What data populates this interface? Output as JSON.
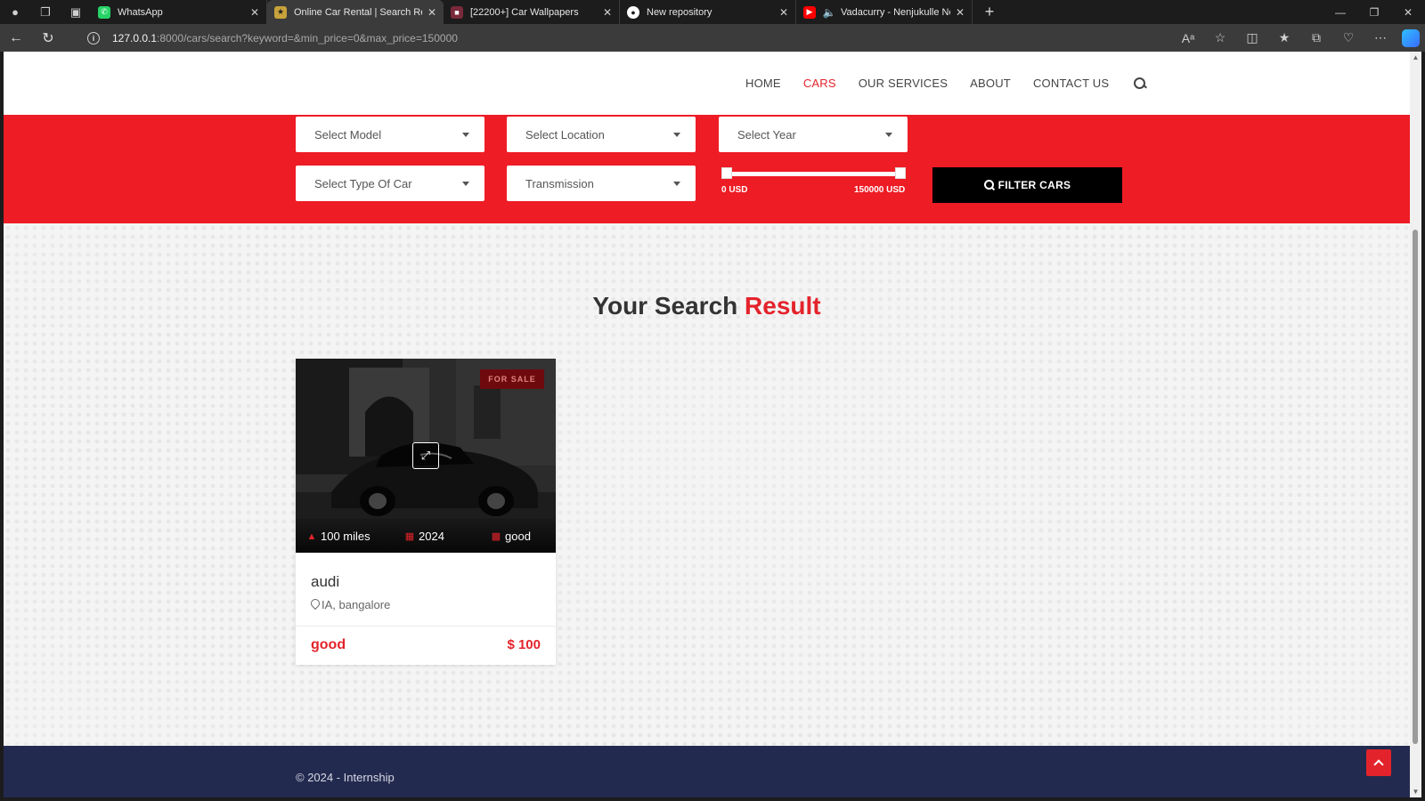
{
  "browser": {
    "tabs": [
      {
        "title": "WhatsApp",
        "favicon": "whatsapp-icon",
        "color": "#25d366"
      },
      {
        "title": "Online Car Rental | Search Result",
        "favicon": "site-icon",
        "color": "#c8a23a"
      },
      {
        "title": "[22200+] Car Wallpapers",
        "favicon": "wallpaper-site-icon",
        "color": "#7a2a3a"
      },
      {
        "title": "New repository",
        "favicon": "github-icon",
        "color": "#ffffff"
      },
      {
        "title": "Vadacurry - Nenjukulle Nee",
        "favicon": "youtube-icon",
        "color": "#ff0000"
      }
    ],
    "url_host": "127.0.0.1",
    "url_path": ":8000/cars/search?keyword=&min_price=0&max_price=150000"
  },
  "nav": {
    "items": [
      "HOME",
      "CARS",
      "OUR SERVICES",
      "ABOUT",
      "CONTACT US"
    ],
    "active": "CARS"
  },
  "filters": {
    "model": "Select Model",
    "location": "Select Location",
    "year": "Select Year",
    "type": "Select Type Of Car",
    "transmission": "Transmission",
    "price_min_label": "0 USD",
    "price_max_label": "150000 USD",
    "button": "FILTER CARS"
  },
  "section": {
    "title_main": "Your Search",
    "title_highlight": "Result"
  },
  "cars": [
    {
      "badge": "FOR SALE",
      "mileage": "100 miles",
      "year": "2024",
      "condition_stat": "good",
      "name": "audi",
      "location": "IA, bangalore",
      "condition": "good",
      "price": "$ 100"
    }
  ],
  "footer": {
    "copyright": "© 2024 - Internship"
  },
  "colors": {
    "accent": "#ee1c25",
    "footer": "#232a4f"
  }
}
